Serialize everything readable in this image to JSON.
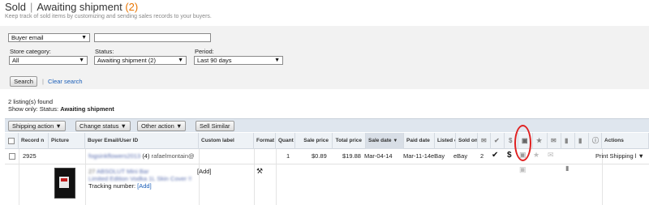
{
  "header": {
    "title_sold": "Sold",
    "title_sep": "|",
    "title_awaiting": "Awaiting shipment",
    "title_count": "(2)",
    "subtitle": "Keep track of sold items by customizing and sending sales records to your buyers."
  },
  "filters": {
    "search_by": "Buyer email",
    "search_value": "",
    "store_category_label": "Store category:",
    "store_category_value": "All",
    "status_label": "Status:",
    "status_value": "Awaiting shipment (2)",
    "period_label": "Period:",
    "period_value": "Last 90 days",
    "search_button": "Search",
    "clear_search": "Clear search"
  },
  "results": {
    "found": "2 listing(s) found",
    "show_only_label": "Show only:",
    "status_label": "Status:",
    "status_value": "Awaiting shipment"
  },
  "toolbar": {
    "shipping_action": "Shipping action",
    "change_status": "Change status",
    "other_action": "Other action",
    "sell_similar": "Sell Similar"
  },
  "columns": {
    "record": "Record n",
    "picture": "Picture",
    "buyer": "Buyer Email/User ID",
    "custom_label": "Custom label",
    "format": "Format",
    "quantity": "Quant",
    "sale_price": "Sale price",
    "total_price": "Total price",
    "sale_date": "Sale date",
    "paid_date": "Paid date",
    "listed_on": "Listed o",
    "sold_on": "Sold on",
    "actions": "Actions"
  },
  "row": {
    "record": "2925",
    "buyer_id": "fogsinkflowers2013",
    "buyer_feedback": "(4)",
    "buyer_email": "rafaelmontain@",
    "custom_label_add": "[Add]",
    "quantity": "1",
    "sale_price": "$0.89",
    "total_price": "$19.88",
    "sale_date": "Mar-04-14",
    "paid_date": "Mar-11-14",
    "listed_on": "eBay",
    "sold_on": "eBay",
    "messages": "2",
    "action": "Print Shipping l",
    "item_number": "27",
    "item_title_line1": "ABSOLUT Mini Bar",
    "item_title_line2": "Limited Edition Vodka 1L Skin Cover !!",
    "tracking_label": "Tracking number:",
    "tracking_add": "[Add]",
    "item_add": "[Add]"
  }
}
